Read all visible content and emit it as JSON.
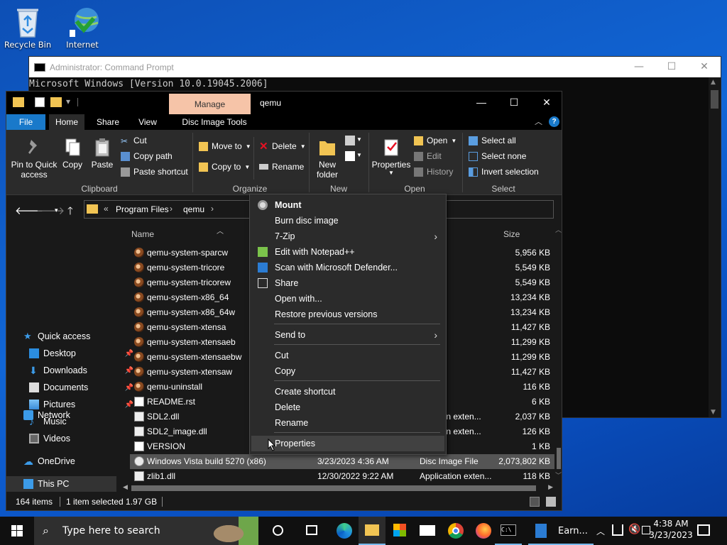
{
  "desktop": {
    "icons": [
      {
        "label": "Recycle Bin"
      },
      {
        "label": "Internet Downloader"
      }
    ]
  },
  "cmd": {
    "title": "Administrator: Command Prompt",
    "line1": "Microsoft Windows [Version 10.0.19045.2006]"
  },
  "explorer": {
    "manage_tab": "Manage",
    "window_title": "qemu",
    "tabs": [
      "File",
      "Home",
      "Share",
      "View",
      "Disc Image Tools"
    ],
    "ribbon": {
      "pin_quick_access_1": "Pin to Quick",
      "pin_quick_access_2": "access",
      "copy": "Copy",
      "paste": "Paste",
      "cut": "Cut",
      "copy_path": "Copy path",
      "paste_shortcut": "Paste shortcut",
      "move_to": "Move to",
      "copy_to": "Copy to",
      "delete": "Delete",
      "rename": "Rename",
      "new_folder_1": "New",
      "new_folder_2": "folder",
      "properties": "Properties",
      "open": "Open",
      "edit": "Edit",
      "history": "History",
      "select_all": "Select all",
      "select_none": "Select none",
      "invert_selection": "Invert selection",
      "groups": [
        "Clipboard",
        "Organize",
        "New",
        "Open",
        "Select"
      ]
    },
    "address": {
      "prefix": "«",
      "crumbs": [
        "Program Files",
        "qemu"
      ]
    },
    "nav": {
      "quick_access": "Quick access",
      "desktop": "Desktop",
      "downloads": "Downloads",
      "documents": "Documents",
      "pictures": "Pictures",
      "music": "Music",
      "videos": "Videos",
      "onedrive": "OneDrive",
      "this_pc": "This PC",
      "network": "Network"
    },
    "columns": {
      "name": "Name",
      "size": "Size"
    },
    "files": [
      {
        "name": "qemu-system-sparcw",
        "date": "",
        "type": "ation",
        "size": "5,956 KB"
      },
      {
        "name": "qemu-system-tricore",
        "date": "",
        "type": "ation",
        "size": "5,549 KB"
      },
      {
        "name": "qemu-system-tricorew",
        "date": "",
        "type": "ation",
        "size": "5,549 KB"
      },
      {
        "name": "qemu-system-x86_64",
        "date": "",
        "type": "ation",
        "size": "13,234 KB"
      },
      {
        "name": "qemu-system-x86_64w",
        "date": "",
        "type": "ation",
        "size": "13,234 KB"
      },
      {
        "name": "qemu-system-xtensa",
        "date": "",
        "type": "ation",
        "size": "11,427 KB"
      },
      {
        "name": "qemu-system-xtensaeb",
        "date": "",
        "type": "ation",
        "size": "11,299 KB"
      },
      {
        "name": "qemu-system-xtensaebw",
        "date": "",
        "type": "ation",
        "size": "11,299 KB"
      },
      {
        "name": "qemu-system-xtensaw",
        "date": "",
        "type": "ation",
        "size": "11,427 KB"
      },
      {
        "name": "qemu-uninstall",
        "date": "",
        "type": "ation",
        "size": "116 KB"
      },
      {
        "name": "README.rst",
        "date": "",
        "type": "",
        "size": "6 KB"
      },
      {
        "name": "SDL2.dll",
        "date": "",
        "type": "plication exten...",
        "size": "2,037 KB"
      },
      {
        "name": "SDL2_image.dll",
        "date": "",
        "type": "plication exten...",
        "size": "126 KB"
      },
      {
        "name": "VERSION",
        "date": "",
        "type": "",
        "size": "1 KB"
      },
      {
        "name": "Windows Vista build 5270 (x86)",
        "date": "3/23/2023 4:36 AM",
        "type": "Disc Image File",
        "size": "2,073,802 KB"
      },
      {
        "name": "zlib1.dll",
        "date": "12/30/2022 9:22 AM",
        "type": "Application exten...",
        "size": "118 KB"
      }
    ],
    "status": {
      "items": "164 items",
      "selected": "1 item selected  1.97 GB"
    }
  },
  "context_menu": {
    "items": [
      {
        "label": "Mount"
      },
      {
        "label": "Burn disc image"
      },
      {
        "label": "7-Zip"
      },
      {
        "label": "Edit with Notepad++"
      },
      {
        "label": "Scan with Microsoft Defender..."
      },
      {
        "label": "Share"
      },
      {
        "label": "Open with..."
      },
      {
        "label": "Restore previous versions"
      },
      {
        "label": "Send to"
      },
      {
        "label": "Cut"
      },
      {
        "label": "Copy"
      },
      {
        "label": "Create shortcut"
      },
      {
        "label": "Delete"
      },
      {
        "label": "Rename"
      },
      {
        "label": "Properties"
      }
    ]
  },
  "taskbar": {
    "search_placeholder": "Type here to search",
    "app_label": "Earn...",
    "time": "4:38 AM",
    "date": "3/23/2023"
  },
  "colors": {
    "file_tab": "#1979ca",
    "manage_tab": "#f6c4a8",
    "taskbar_active": "#76b9ed"
  }
}
